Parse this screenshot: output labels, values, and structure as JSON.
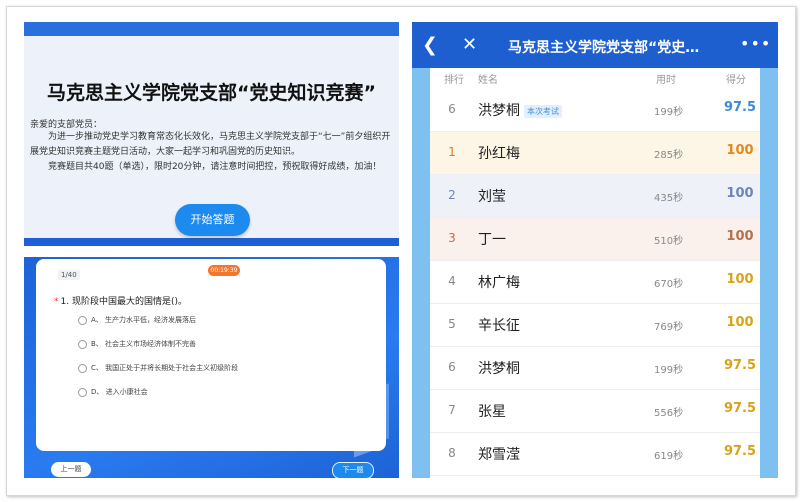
{
  "intro": {
    "title": "马克思主义学院党支部“党史知识竞赛”",
    "greeting": "亲爱的支部党员：",
    "para1": "为进一步推动党史学习教育常态化长效化，马克思主义学院党支部于“七一”前夕组织开展党史知识竞赛主题党日活动，大家一起学习和巩固党的历史知识。",
    "para2": "竞赛题目共40题（单选），限时20分钟，请注意时间把控，预祝取得好成绩，加油！",
    "start_button": "开始答题"
  },
  "quiz": {
    "timer": "00:19:39",
    "counter": "1/40",
    "question": "1. 现阶段中国最大的国情是()。",
    "options": [
      "A、 生产力水平低，经济发展落后",
      "B、 社会主义市场经济体制不完善",
      "C、 我国正处于并将长期处于社会主义初级阶段",
      "D、 进入小康社会"
    ],
    "prev_button": "上一题",
    "next_button": "下一题"
  },
  "board": {
    "title": "马克思主义学院党支部“党史…",
    "header": {
      "rank": "排行",
      "name": "姓名",
      "time": "用时",
      "score": "得分"
    },
    "rows": [
      {
        "rank": "6",
        "name": "洪梦桐",
        "tag": "本次考试",
        "time": "199秒",
        "score": "97.5"
      },
      {
        "rank": "1",
        "name": "孙红梅",
        "time": "285秒",
        "score": "100"
      },
      {
        "rank": "2",
        "name": "刘莹",
        "time": "435秒",
        "score": "100"
      },
      {
        "rank": "3",
        "name": "丁一",
        "time": "510秒",
        "score": "100"
      },
      {
        "rank": "4",
        "name": "林广梅",
        "time": "670秒",
        "score": "100"
      },
      {
        "rank": "5",
        "name": "辛长征",
        "time": "769秒",
        "score": "100"
      },
      {
        "rank": "6",
        "name": "洪梦桐",
        "time": "199秒",
        "score": "97.5"
      },
      {
        "rank": "7",
        "name": "张星",
        "time": "556秒",
        "score": "97.5"
      },
      {
        "rank": "8",
        "name": "郑雪滢",
        "time": "619秒",
        "score": "97.5"
      }
    ]
  },
  "icons": {
    "back": "back-arrow-icon",
    "close": "close-icon",
    "more": "more-icon"
  },
  "colors": {
    "primary": "#1e5fcf",
    "button": "#1d8af0",
    "timer": "#f5762b"
  }
}
